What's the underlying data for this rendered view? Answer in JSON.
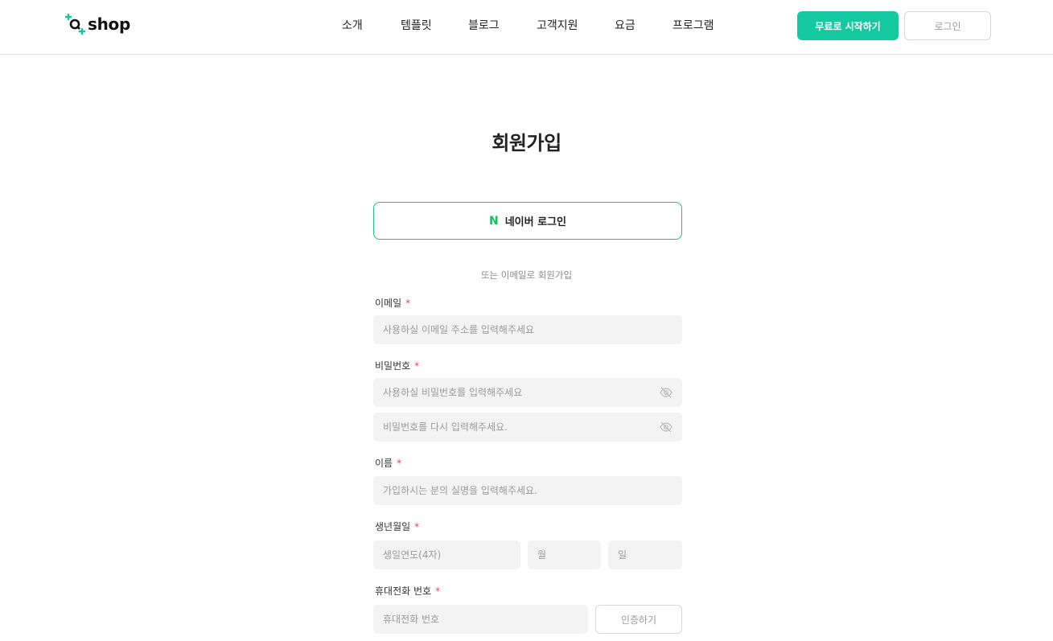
{
  "header": {
    "logo_text": "shop",
    "nav": [
      "소개",
      "템플릿",
      "블로그",
      "고객지원",
      "요금",
      "프로그램"
    ],
    "start_button": "무료로 시작하기",
    "login_button": "로그인",
    "brand_color": "#14c9a0"
  },
  "main": {
    "title": "회원가입",
    "naver_button": "네이버 로그인",
    "naver_icon": "N",
    "naver_color": "#03c75a",
    "divider": "또는 이메일로 회원가입",
    "required_mark": "*",
    "email": {
      "label": "이메일",
      "placeholder": "사용하실 이메일 주소를 입력해주세요"
    },
    "password": {
      "label": "비밀번호",
      "placeholder": "사용하실 비밀번호를 입력해주세요",
      "confirm_placeholder": "비밀번호를 다시 입력해주세요."
    },
    "name": {
      "label": "이름",
      "placeholder": "가입하시는 분의 실명을 입력해주세요."
    },
    "birth": {
      "label": "생년월일",
      "year_placeholder": "생일연도(4자)",
      "month_placeholder": "월",
      "day_placeholder": "일"
    },
    "phone": {
      "label": "휴대전화 번호",
      "placeholder": "휴대전화 번호",
      "verify_button": "인증하기"
    }
  }
}
